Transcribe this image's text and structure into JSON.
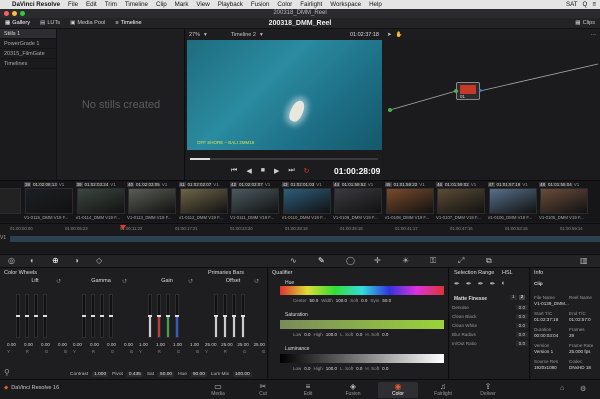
{
  "menubar": {
    "app": "DaVinci Resolve",
    "items": [
      "File",
      "Edit",
      "Trim",
      "Timeline",
      "Clip",
      "Mark",
      "View",
      "Playback",
      "Fusion",
      "Color",
      "Fairlight",
      "Workspace",
      "Help"
    ],
    "right": [
      "SAT",
      "Q",
      "≡"
    ]
  },
  "window_title": "200318_DMM_Reel",
  "toolbar": {
    "gallery": "Gallery",
    "luts": "LUTs",
    "media_pool": "Media Pool",
    "timeline": "Timeline",
    "project_title": "200318_DMM_Reel",
    "clips": "Clips"
  },
  "stills": {
    "items": [
      "Stills 1",
      "PowerGrade 1",
      "20315_FilmGate",
      "Timelines"
    ],
    "empty_message": "No stills created"
  },
  "viewer": {
    "zoom": "27%",
    "timeline_name": "Timeline 2",
    "header_timecode": "01:02:37:18",
    "caption": "OFF SHORE – BALI 2MM18",
    "timecode": "01:00:28:09"
  },
  "clips": [
    {
      "num": "38",
      "tc": "01:02:08:13",
      "v": "V1",
      "name": "V1-0115_DMM V19 F...",
      "color": "#1c2024"
    },
    {
      "num": "39",
      "tc": "01:02:03:24",
      "v": "V1",
      "name": "V1-0114_DMM V19 F...",
      "color": "#3c4740"
    },
    {
      "num": "40",
      "tc": "01:02:03:05",
      "v": "V1",
      "name": "V1-0113_DMM V19 F...",
      "color": "#5a5e55"
    },
    {
      "num": "41",
      "tc": "01:02:02:07",
      "v": "V1",
      "name": "V1-0112_DMM V19 F...",
      "color": "#6e6448"
    },
    {
      "num": "42",
      "tc": "01:02:02:07",
      "v": "V1",
      "name": "V1-0111_DMM V19 F...",
      "color": "#4c5a60"
    },
    {
      "num": "43",
      "tc": "01:02:01:03",
      "v": "V1",
      "name": "V1-0110_DMM V19 F...",
      "color": "#2d5d7c"
    },
    {
      "num": "44",
      "tc": "01:01:59:52",
      "v": "V1",
      "name": "V1-0109_DMM V19 F...",
      "color": "#3a3a40"
    },
    {
      "num": "45",
      "tc": "01:01:59:22",
      "v": "V1",
      "name": "V1-0108_DMM V19 F...",
      "color": "#7a4a2c"
    },
    {
      "num": "46",
      "tc": "01:01:59:02",
      "v": "V1",
      "name": "V1-0107_DMM V19 F...",
      "color": "#5b4b34"
    },
    {
      "num": "47",
      "tc": "01:01:57:19",
      "v": "V1",
      "name": "V1-0106_DMM V19 F...",
      "color": "#56708a"
    },
    {
      "num": "48",
      "tc": "01:01:55:04",
      "v": "V1",
      "name": "V1-0105_DMM V19 F...",
      "color": "#6a4c3a"
    }
  ],
  "ruler": [
    "01:00:00:00",
    "01:00:05:23",
    "01:00:11:22",
    "01:00:17:21",
    "01:00:23:20",
    "01:00:29:19",
    "01:00:35:18",
    "01:00:41:17",
    "01:00:47:16",
    "01:00:53:15",
    "01:00:59:14"
  ],
  "track_label": "V1",
  "color_wheels": {
    "title": "Color Wheels",
    "mode": "Primaries Bars",
    "wheels": [
      {
        "name": "Lift",
        "vals": [
          "0.00",
          "0.00",
          "0.00",
          "0.00"
        ]
      },
      {
        "name": "Gamma",
        "vals": [
          "0.00",
          "0.00",
          "0.00",
          "0.00"
        ]
      },
      {
        "name": "Gain",
        "vals": [
          "1.00",
          "1.00",
          "1.00",
          "1.00"
        ]
      },
      {
        "name": "Offset",
        "vals": [
          "25.00",
          "25.00",
          "25.00",
          "25.00"
        ]
      }
    ],
    "channel_labels": [
      "Y",
      "R",
      "G",
      "B"
    ],
    "footer": {
      "contrast_label": "Contrast",
      "contrast": "1.000",
      "pivot_label": "Pivot",
      "pivot": "0.435",
      "sat_label": "Sat",
      "sat": "50.00",
      "hue_label": "Hue",
      "hue": "50.00",
      "lummix_label": "Lum Mix",
      "lummix": "100.00"
    }
  },
  "qualifier": {
    "title": "Qualifier",
    "mode": "HSL",
    "hue": {
      "label": "Hue",
      "center_label": "Center",
      "center": "50.0",
      "width_label": "Width",
      "width": "100.0",
      "soft_label": "Soft",
      "soft": "0.0",
      "sym_label": "Sym",
      "sym": "50.0"
    },
    "saturation": {
      "label": "Saturation",
      "low_label": "Low",
      "low": "0.0",
      "high_label": "High",
      "high": "100.0",
      "lsoft_label": "L. Soft",
      "lsoft": "0.0",
      "hsoft_label": "H. Soft",
      "hsoft": "0.0"
    },
    "luminance": {
      "label": "Luminance",
      "low_label": "Low",
      "low": "0.0",
      "high_label": "High",
      "high": "100.0",
      "lsoft_label": "L. Soft",
      "lsoft": "0.0",
      "hsoft_label": "H. Soft",
      "hsoft": "0.0"
    }
  },
  "selection": {
    "title": "Selection Range",
    "matte_finesse": "Matte Finesse",
    "pages": [
      "1",
      "2"
    ],
    "rows": [
      {
        "k": "Denoise",
        "v": "0.0"
      },
      {
        "k": "Clean Black",
        "v": "0.0"
      },
      {
        "k": "Clean White",
        "v": "0.0"
      },
      {
        "k": "Blur Radius",
        "v": "0.0"
      },
      {
        "k": "In/Out Ratio",
        "v": "0.0"
      }
    ]
  },
  "info": {
    "title": "Info",
    "clip_label": "Clip",
    "file_name_k": "File Name",
    "file_name_v": "V1-0139_DMM...",
    "reel_name_k": "Reel Name",
    "start_tc_k": "Start T/C",
    "start_tc_v": "01:02:37:18",
    "end_tc_k": "End T/C",
    "end_tc_v": "01:02:57:0",
    "duration_k": "Duration",
    "duration_v": "00:00:03:04",
    "frames_k": "Frames",
    "frames_v": "29",
    "version_k": "Version",
    "version_v": "Version 1",
    "frame_rate_k": "Frame Rate",
    "frame_rate_v": "25.000 fps",
    "source_res_k": "Source Res",
    "source_res_v": "1920x1080",
    "codec_k": "Codec",
    "codec_v": "DNxHD 18"
  },
  "pages": [
    "Media",
    "Cut",
    "Edit",
    "Fusion",
    "Color",
    "Fairlight",
    "Deliver"
  ],
  "active_page": "Color",
  "brand": "DaVinci Resolve 16"
}
